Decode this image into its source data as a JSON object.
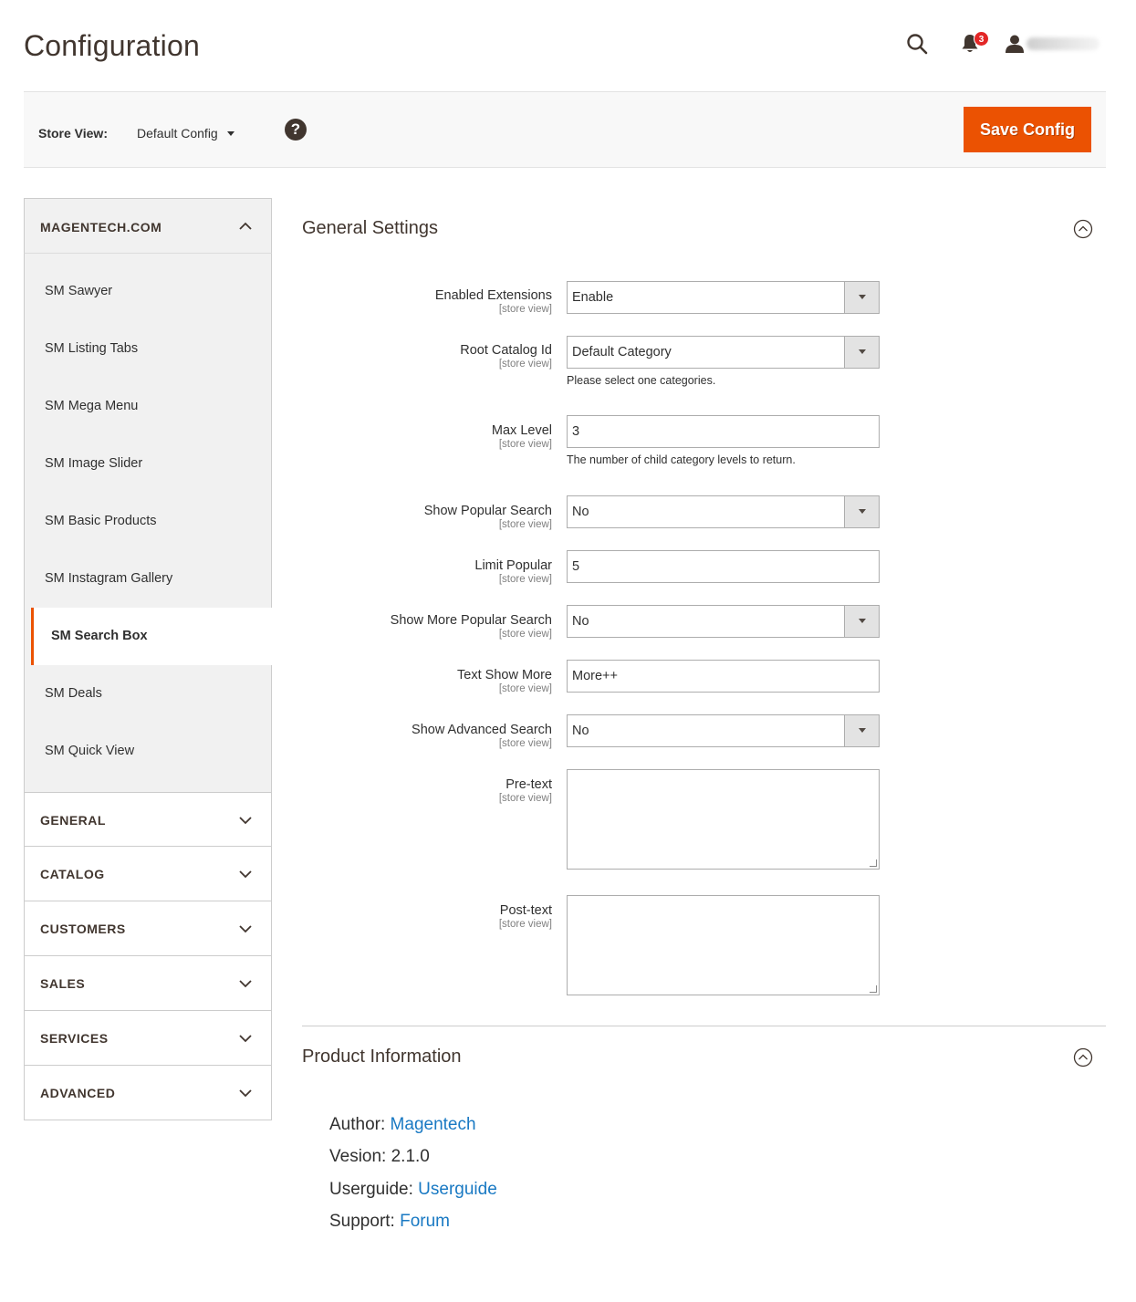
{
  "page": {
    "title": "Configuration"
  },
  "header": {
    "notifications_count": "3"
  },
  "store_bar": {
    "label": "Store View:",
    "selected": "Default Config",
    "help": "?",
    "save_label": "Save Config"
  },
  "sidebar": {
    "group_label": "MAGENTECH.COM",
    "items": [
      {
        "label": "SM Sawyer",
        "active": false
      },
      {
        "label": "SM Listing Tabs",
        "active": false
      },
      {
        "label": "SM Mega Menu",
        "active": false
      },
      {
        "label": "SM Image Slider",
        "active": false
      },
      {
        "label": "SM Basic Products",
        "active": false
      },
      {
        "label": "SM Instagram Gallery",
        "active": false
      },
      {
        "label": "SM Search Box",
        "active": true
      },
      {
        "label": "SM Deals",
        "active": false
      },
      {
        "label": "SM Quick View",
        "active": false
      }
    ],
    "sections": [
      "GENERAL",
      "CATALOG",
      "CUSTOMERS",
      "SALES",
      "SERVICES",
      "ADVANCED"
    ]
  },
  "general_settings": {
    "title": "General Settings",
    "scope": "[store view]",
    "fields": [
      {
        "label": "Enabled Extensions",
        "value": "Enable"
      },
      {
        "label": "Root Catalog Id",
        "value": "Default Category",
        "note": "Please select one categories."
      },
      {
        "label": "Max Level",
        "value": "3",
        "note": "The number of child category levels to return."
      },
      {
        "label": "Show Popular Search",
        "value": "No"
      },
      {
        "label": "Limit Popular",
        "value": "5"
      },
      {
        "label": "Show More Popular Search",
        "value": "No"
      },
      {
        "label": "Text Show More",
        "value": "More++"
      },
      {
        "label": "Show Advanced Search",
        "value": "No"
      },
      {
        "label": "Pre-text",
        "value": ""
      },
      {
        "label": "Post-text",
        "value": ""
      }
    ]
  },
  "product_info": {
    "title": "Product Information",
    "author_label": "Author:",
    "author_link": "Magentech",
    "version_text": "Vesion: 2.1.0",
    "guide_label": "Userguide:",
    "guide_link": "Userguide",
    "support_label": "Support:",
    "support_link": "Forum"
  },
  "colors": {
    "accent": "#eb5202",
    "link": "#1979c3",
    "badge": "#e22626",
    "text_dark": "#41362f"
  }
}
